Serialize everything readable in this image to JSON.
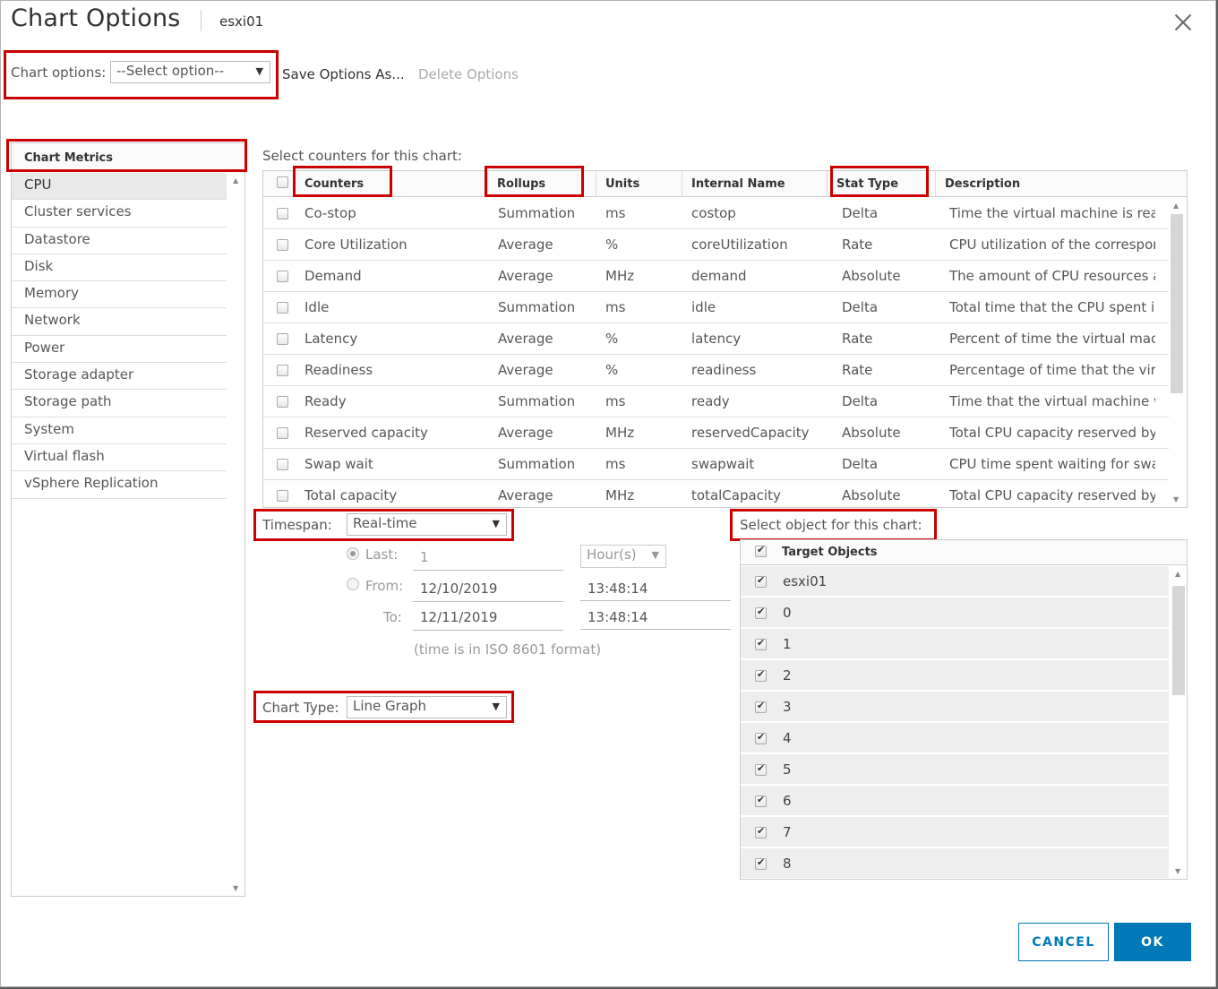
{
  "dialog": {
    "title": "Chart Options",
    "subtitle": "esxi01"
  },
  "options_bar": {
    "label": "Chart options:",
    "select_value": "--Select option--",
    "save_label": "Save Options As...",
    "delete_label": "Delete Options"
  },
  "metrics": {
    "header": "Chart Metrics",
    "items": [
      "CPU",
      "Cluster services",
      "Datastore",
      "Disk",
      "Memory",
      "Network",
      "Power",
      "Storage adapter",
      "Storage path",
      "System",
      "Virtual flash",
      "vSphere Replication"
    ],
    "selected": "CPU"
  },
  "counters": {
    "caption": "Select counters for this chart:",
    "columns": [
      "Counters",
      "Rollups",
      "Units",
      "Internal Name",
      "Stat Type",
      "Description"
    ],
    "rows": [
      [
        "Co-stop",
        "Summation",
        "ms",
        "costop",
        "Delta",
        "Time the virtual machine is read..."
      ],
      [
        "Core Utilization",
        "Average",
        "%",
        "coreUtilization",
        "Rate",
        "CPU utilization of the correspon..."
      ],
      [
        "Demand",
        "Average",
        "MHz",
        "demand",
        "Absolute",
        "The amount of CPU resources a..."
      ],
      [
        "Idle",
        "Summation",
        "ms",
        "idle",
        "Delta",
        "Total time that the CPU spent in ..."
      ],
      [
        "Latency",
        "Average",
        "%",
        "latency",
        "Rate",
        "Percent of time the virtual machi..."
      ],
      [
        "Readiness",
        "Average",
        "%",
        "readiness",
        "Rate",
        "Percentage of time that the virtu..."
      ],
      [
        "Ready",
        "Summation",
        "ms",
        "ready",
        "Delta",
        "Time that the virtual machine w..."
      ],
      [
        "Reserved capacity",
        "Average",
        "MHz",
        "reservedCapacity",
        "Absolute",
        "Total CPU capacity reserved by ..."
      ],
      [
        "Swap wait",
        "Summation",
        "ms",
        "swapwait",
        "Delta",
        "CPU time spent waiting for swa..."
      ],
      [
        "Total capacity",
        "Average",
        "MHz",
        "totalCapacity",
        "Absolute",
        "Total CPU capacity reserved by ..."
      ]
    ]
  },
  "timespan": {
    "label": "Timespan:",
    "select_value": "Real-time",
    "last_label": "Last:",
    "last_value": "1",
    "last_unit": "Hour(s)",
    "from_label": "From:",
    "from_date": "12/10/2019",
    "from_time": "13:48:14",
    "to_label": "To:",
    "to_date": "12/11/2019",
    "to_time": "13:48:14",
    "note": "(time is in ISO 8601 format)"
  },
  "chart_type": {
    "label": "Chart Type:",
    "select_value": "Line Graph"
  },
  "targets": {
    "caption": "Select object for this chart:",
    "header": "Target Objects",
    "rows": [
      "esxi01",
      "0",
      "1",
      "2",
      "3",
      "4",
      "5",
      "6",
      "7",
      "8"
    ]
  },
  "buttons": {
    "cancel": "CANCEL",
    "ok": "OK"
  },
  "colors": {
    "accent": "#0079b8",
    "highlight_box": "#cc0000"
  }
}
